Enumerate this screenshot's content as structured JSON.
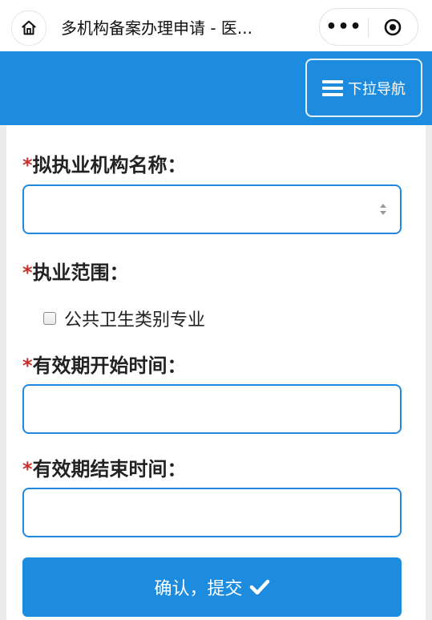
{
  "topbar": {
    "title": "多机构备案办理申请 - 医...",
    "more_label": "•••"
  },
  "header": {
    "nav_toggle_label": "下拉导航"
  },
  "form": {
    "org_name": {
      "required_mark": "*",
      "label": "拟执业机构名称：",
      "value": ""
    },
    "scope": {
      "required_mark": "*",
      "label": "执业范围：",
      "options": [
        {
          "label": "公共卫生类别专业",
          "checked": false
        }
      ]
    },
    "start_date": {
      "required_mark": "*",
      "label": "有效期开始时间：",
      "value": ""
    },
    "end_date": {
      "required_mark": "*",
      "label": "有效期结束时间：",
      "value": ""
    },
    "submit_label": "确认，提交"
  },
  "icons": {
    "home": "home-icon",
    "close": "target-close-icon",
    "menu": "hamburger-icon",
    "select": "select-arrows-icon",
    "check": "checkmark-icon"
  },
  "colors": {
    "primary": "#1d8bde",
    "field_border": "#2188e0",
    "required": "#c9302c"
  }
}
